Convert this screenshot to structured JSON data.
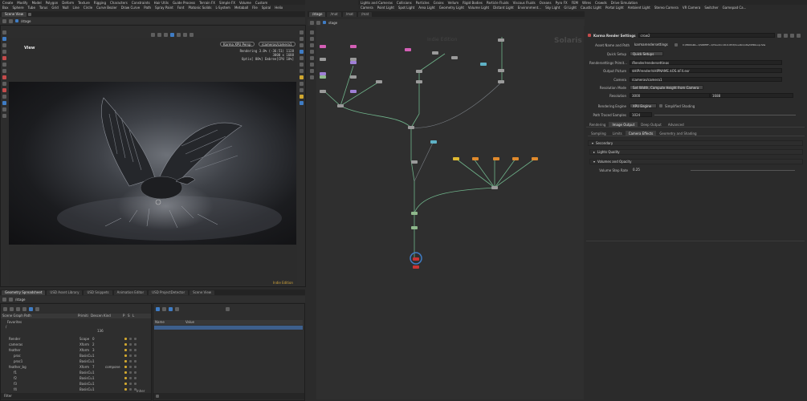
{
  "top_menu_1": [
    "Create",
    "Modify",
    "Model",
    "Polygon",
    "Deform",
    "Texture",
    "Rigging",
    "Characters",
    "Constraints",
    "Hair Utils",
    "Guide Process",
    "Terrain FX",
    "Simple FX",
    "Volume",
    "Custom"
  ],
  "top_menu_2": [
    "Box",
    "Sphere",
    "Tube",
    "Torus",
    "Grid",
    "Null",
    "Line",
    "Circle",
    "Curve Bezier",
    "Draw Curve",
    "Path",
    "Spray Paint",
    "Font",
    "Platonic Solids",
    "L-System",
    "Metaball",
    "File",
    "Spiral",
    "Helix"
  ],
  "lights_menu_1": [
    "Lights and Cameras",
    "Collisions",
    "Particles",
    "Grains",
    "Vellum",
    "Rigid Bodies",
    "Particle Fluids",
    "Viscous Fluids",
    "Oceans",
    "Pyro FX",
    "FEM",
    "Wires",
    "Crowds",
    "Drive Simulation"
  ],
  "lights_menu_2": [
    "Camera",
    "Point Light",
    "Spot Light",
    "Area Light",
    "Geometry Light",
    "Volume Light",
    "Distant Light",
    "Environment...",
    "Sky Light",
    "GI Light",
    "Caustic Light",
    "Portal Light",
    "Ambient Light",
    "Stereo Camera",
    "VR Camera",
    "Switcher",
    "Gamepad Ca..."
  ],
  "scene_view_tab": "Scene View",
  "left_path": "/stage",
  "network_paths": [
    "/stage",
    "/mat",
    "/mat",
    "/mat"
  ],
  "network_path_bar": "stage",
  "viewport": {
    "title": "View",
    "camera_pill": "Karma XPU  Persp",
    "camera_path": "/cameras/camera1",
    "stats_lines": [
      "Rendering  3.0%  (-36:51)  1128",
      "3000 x 1688",
      "Optix[ 80%] Embree[CPU 10%]"
    ],
    "indie_label": "Indie Edition"
  },
  "spreadsheet": {
    "tabs": [
      "Geometry Spreadsheet",
      "USD Asset Library",
      "USD Snippets",
      "Animation Editor",
      "USD ProjectDetector",
      "Scene View"
    ],
    "path": "/stage",
    "headers": [
      "Scene Graph Path",
      "Primiti",
      "Descen",
      "Kind",
      "P",
      "S",
      "L"
    ],
    "favorites_label": "Favorites",
    "root_count": "136",
    "rows": [
      {
        "name": "Render",
        "prim": "Scope",
        "desc": "0",
        "kind": ""
      },
      {
        "name": "cameras",
        "prim": "Xform",
        "desc": "2",
        "kind": ""
      },
      {
        "name": "feather",
        "prim": "Xform",
        "desc": "3",
        "kind": ""
      },
      {
        "name": "proc",
        "prim": "BasisCu",
        "desc": "1",
        "kind": ""
      },
      {
        "name": "proc1",
        "prim": "BasisCu",
        "desc": "1",
        "kind": ""
      },
      {
        "name": "feather_bg",
        "prim": "Xform",
        "desc": "7",
        "kind": "compone"
      },
      {
        "name": "f1",
        "prim": "BasisCu",
        "desc": "1",
        "kind": ""
      },
      {
        "name": "f2",
        "prim": "BasisCu",
        "desc": "1",
        "kind": ""
      },
      {
        "name": "f3",
        "prim": "BasisCu",
        "desc": "1",
        "kind": ""
      },
      {
        "name": "f4",
        "prim": "BasisCu",
        "desc": "1",
        "kind": ""
      }
    ],
    "filter_label": "Filter",
    "details_headers": [
      "Name",
      "Value"
    ],
    "inherit_label": "Inher"
  },
  "network": {
    "watermark": "Solaris",
    "indie_watermark": "Indie Edition"
  },
  "params": {
    "node_type": "Karma Render Settings",
    "node_name": "crow2",
    "asset_label": "Asset Name and Path",
    "asset_name": "karmarendersettings",
    "asset_path": "C:/PROGRA~1/SIDEEF~1/Houdini 20.0.653/houdini/otls/OPlibLop.hda",
    "quick_setup_label": "Quick Setup",
    "quick_setup_value": "Quick Setups",
    "rs_prim_label": "Rendersettings Primit...",
    "rs_prim_value": "/Render/rendersettings",
    "output_label": "Output Picture",
    "output_value": "$HIP/render/$HIPNAME.$OS.$F4.exr",
    "camera_label": "Camera",
    "camera_value": "/cameras/camera1",
    "res_mode_label": "Resolution Mode",
    "res_mode_value": "Set Width, Compute Height from Camera",
    "res_label": "Resolution",
    "res_w": "3000",
    "res_h": "1688",
    "engine_label": "Rendering Engine",
    "engine_value": "XPU Engine",
    "simplified_label": "Simplified Shading",
    "samples_label": "Path Traced Samples",
    "samples_value": "1024",
    "main_tabs": [
      "Rendering",
      "Image Output",
      "Deep Output",
      "Advanced"
    ],
    "sub_tabs": [
      "Sampling",
      "Limits",
      "Camera Effects",
      "Geometry and Shading"
    ],
    "folders": [
      "Secondary",
      "Lights Quality",
      "Volumes and Opacity"
    ],
    "volume_step_label": "Volume Step Rate",
    "volume_step_value": "0.25"
  },
  "colors": {
    "accent": "#3f7cc4",
    "selection": "#3d5f8c",
    "node_pink": "#d45fb6",
    "node_yellow": "#e0b931",
    "node_orange": "#e08a2c",
    "wire_green": "#6fb38a"
  }
}
